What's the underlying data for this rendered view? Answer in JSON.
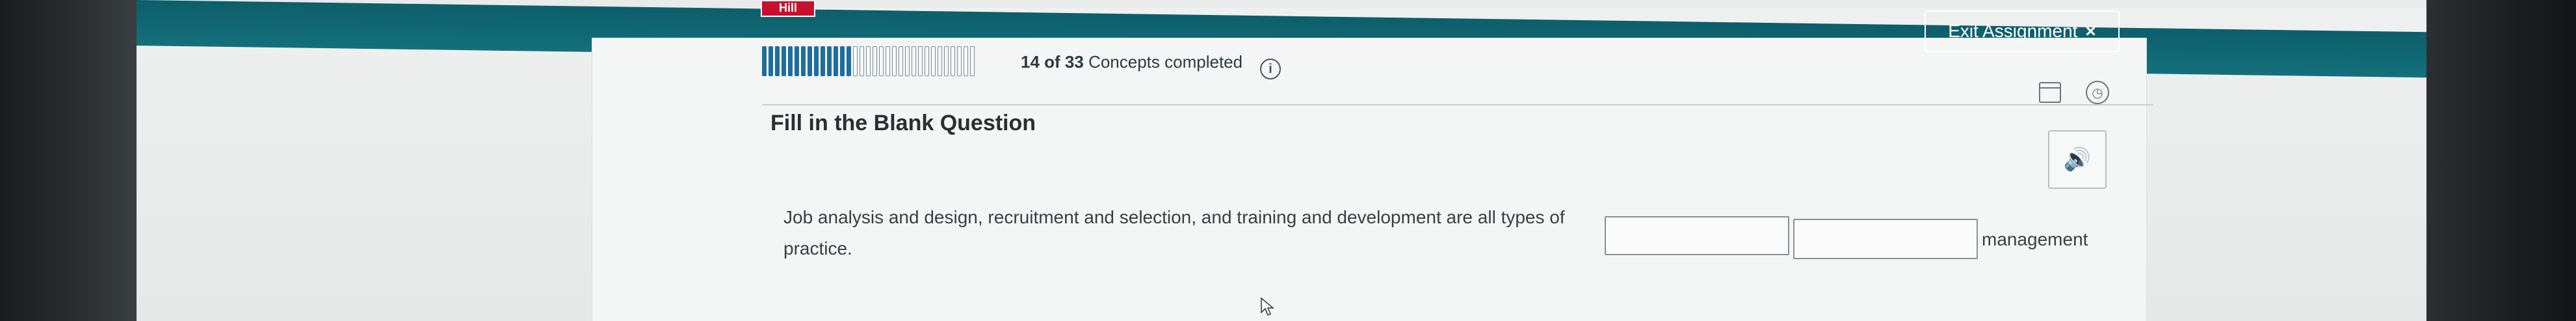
{
  "header": {
    "logo_text": "Hill",
    "exit_label": "Exit Assignment",
    "exit_icon": "×"
  },
  "progress": {
    "completed": 14,
    "total": 33,
    "text_count": "14 of 33",
    "text_suffix": "Concepts completed",
    "info_icon": "i"
  },
  "question": {
    "title": "Fill in the Blank Question",
    "text_before": "Job analysis and design, recruitment and selection, and training and development are all types of",
    "text_after": "management",
    "text_line2": "practice.",
    "blank1_value": "",
    "blank2_value": ""
  },
  "icons": {
    "calendar": "calendar-icon",
    "clock": "clock-icon",
    "audio": "🔊"
  },
  "colors": {
    "header_teal": "#13707c",
    "progress_done": "#1f6d9a",
    "logo_red": "#c8102e"
  }
}
